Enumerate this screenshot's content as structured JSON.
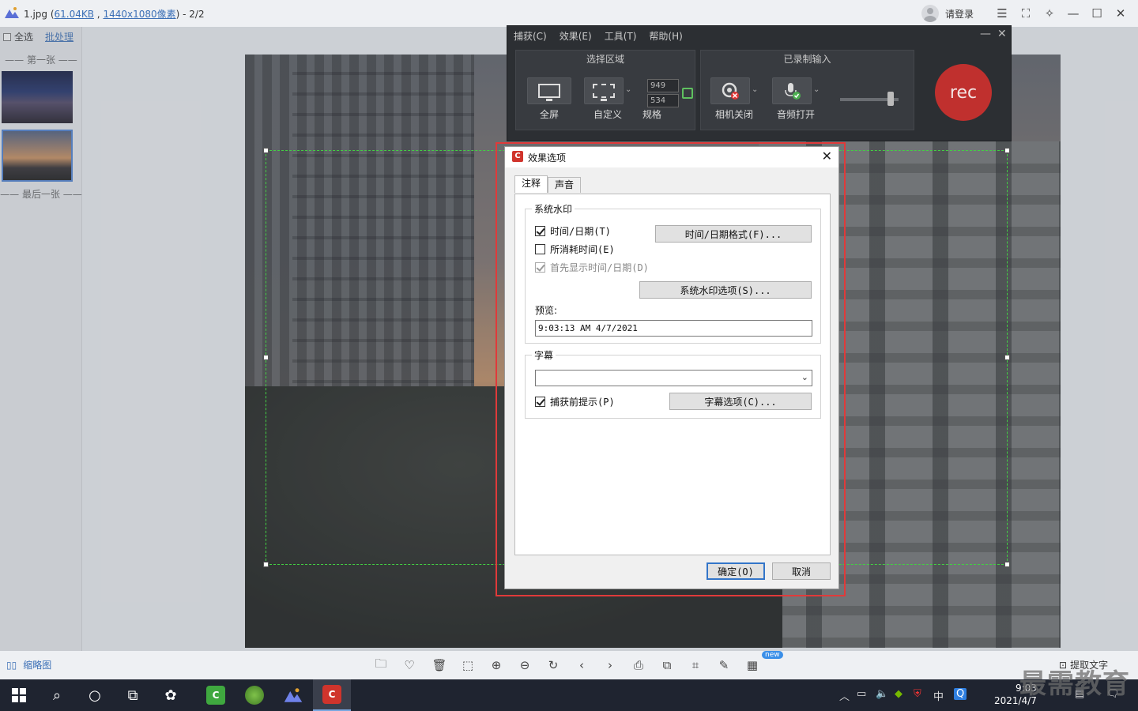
{
  "viewer": {
    "title_prefix": "1.jpg (",
    "file_size": "61.04KB",
    "title_sep": " , ",
    "resolution": "1440x1080像素",
    "title_suffix": ") - 2/2",
    "login_label": "请登录"
  },
  "sidebar": {
    "select_all": "全选",
    "batch": "批处理",
    "first_label": "—— 第一张 ——",
    "last_label": "—— 最后一张 ——"
  },
  "bottombar": {
    "thumbs_label": "缩略图",
    "new_badge": "new",
    "ocr_label": "提取文字"
  },
  "recorder": {
    "menu": [
      "捕获(C)",
      "效果(E)",
      "工具(T)",
      "帮助(H)"
    ],
    "select_area_title": "选择区域",
    "fullscreen_label": "全屏",
    "custom_label": "自定义",
    "size_label": "规格",
    "width_value": "949",
    "height_value": "534",
    "recorded_input_title": "已录制输入",
    "camera_label": "相机关闭",
    "audio_label": "音频打开",
    "rec_label": "rec"
  },
  "dialog": {
    "title": "效果选项",
    "tabs": [
      {
        "label": "注释",
        "active": true
      },
      {
        "label": "声音",
        "active": false
      }
    ],
    "watermark_group": "系统水印",
    "timedate_cb": {
      "label": "时间/日期(T)",
      "checked": true
    },
    "elapsed_cb": {
      "label": "所消耗时间(E)",
      "checked": false
    },
    "show_first_cb": {
      "label": "首先显示时间/日期(D)",
      "checked": true,
      "disabled": true
    },
    "timedate_format_btn": "时间/日期格式(F)...",
    "watermark_options_btn": "系统水印选项(S)...",
    "preview_label": "预览:",
    "preview_value": "9:03:13 AM 4/7/2021",
    "caption_group": "字幕",
    "caption_value": "",
    "prompt_cb": {
      "label": "捕获前提示(P)",
      "checked": true
    },
    "caption_options_btn": "字幕选项(C)...",
    "ok_btn": "确定(O)",
    "cancel_btn": "取消"
  },
  "taskbar": {
    "ime": "中",
    "time": "9:03",
    "date": "2021/4/7"
  },
  "watermark_text": "最需教育",
  "colors": {
    "accent": "#3b6fb6",
    "rec_red": "#c0302e",
    "highlight_red": "#e03a3a",
    "selection_green": "#43d043"
  }
}
